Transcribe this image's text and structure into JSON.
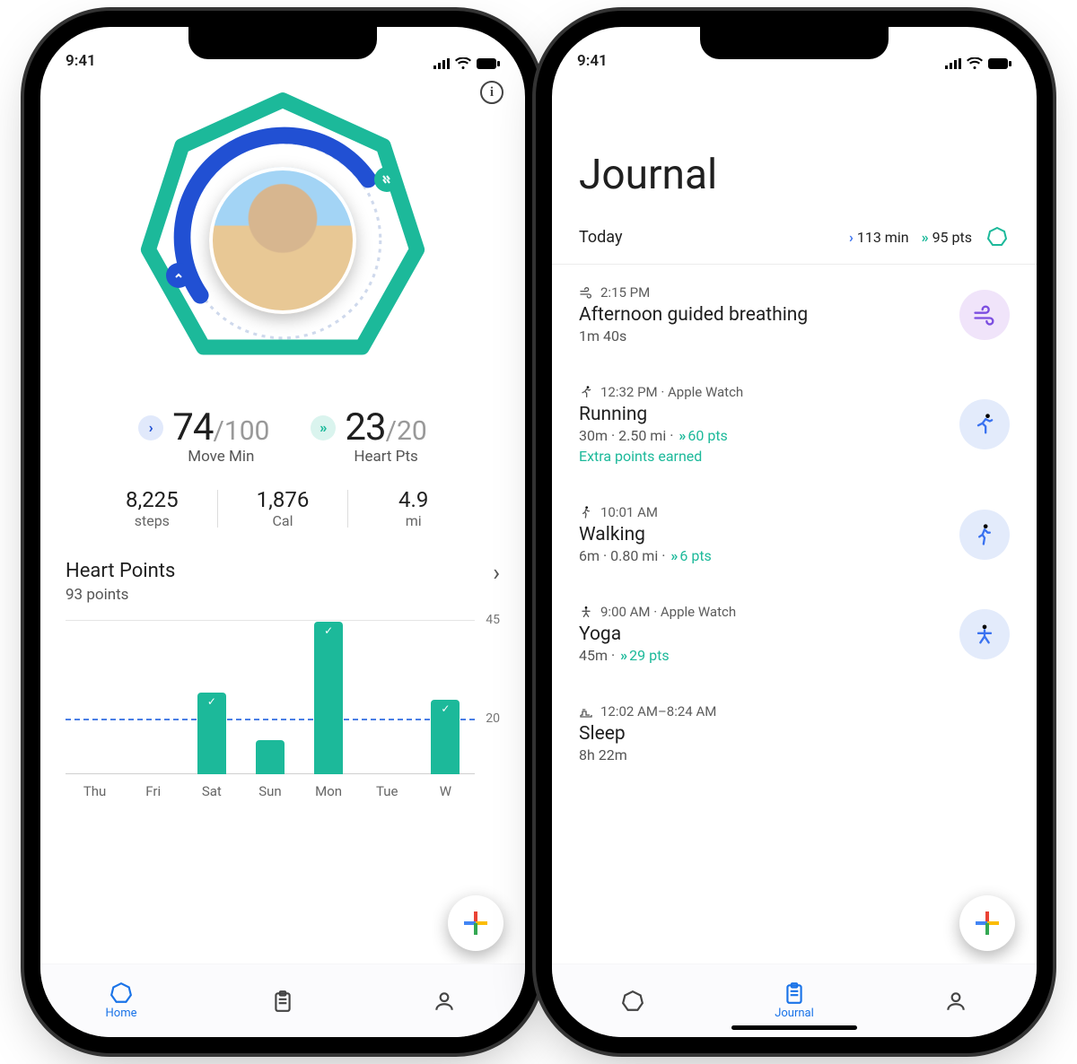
{
  "status": {
    "time": "9:41"
  },
  "home": {
    "move": {
      "value": "74",
      "goal": "/100",
      "label": "Move Min"
    },
    "heart": {
      "value": "23",
      "goal": "/20",
      "label": "Heart Pts"
    },
    "steps": {
      "value": "8,225",
      "label": "steps"
    },
    "cal": {
      "value": "1,876",
      "label": "Cal"
    },
    "dist": {
      "value": "4.9",
      "label": "mi"
    },
    "section": {
      "title": "Heart Points",
      "sub": "93 points"
    },
    "tabs": {
      "home": "Home"
    }
  },
  "chart_data": {
    "type": "bar",
    "categories": [
      "Thu",
      "Fri",
      "Sat",
      "Sun",
      "Mon",
      "Tue",
      "W"
    ],
    "values": [
      0,
      0,
      24,
      10,
      45,
      0,
      22
    ],
    "goal_line": 20,
    "ylim": [
      0,
      45
    ],
    "tick_labels": {
      "top": "45",
      "goal": "20"
    }
  },
  "journal": {
    "title": "Journal",
    "today": {
      "label": "Today",
      "min": "113 min",
      "pts": "95 pts"
    },
    "entries": [
      {
        "meta_time": "2:15 PM",
        "meta_src": "",
        "title": "Afternoon guided breathing",
        "desc": "1m 40s",
        "pts": "",
        "extra": "",
        "icon": "breath",
        "color": "purple"
      },
      {
        "meta_time": "12:32 PM",
        "meta_src": "Apple Watch",
        "title": "Running",
        "desc": "30m · 2.50 mi · ",
        "pts": "60 pts",
        "extra": "Extra points earned",
        "icon": "run",
        "color": "blue"
      },
      {
        "meta_time": "10:01 AM",
        "meta_src": "",
        "title": "Walking",
        "desc": "6m · 0.80 mi · ",
        "pts": "6 pts",
        "extra": "",
        "icon": "walk",
        "color": "blue"
      },
      {
        "meta_time": "9:00 AM",
        "meta_src": "Apple Watch",
        "title": "Yoga",
        "desc": "45m · ",
        "pts": "29 pts",
        "extra": "",
        "icon": "yoga",
        "color": "blue"
      },
      {
        "meta_time": "12:02 AM–8:24 AM",
        "meta_src": "",
        "title": "Sleep",
        "desc": "8h 22m",
        "pts": "",
        "extra": "",
        "icon": "sleep",
        "color": "none"
      }
    ],
    "tabs": {
      "journal": "Journal"
    }
  }
}
